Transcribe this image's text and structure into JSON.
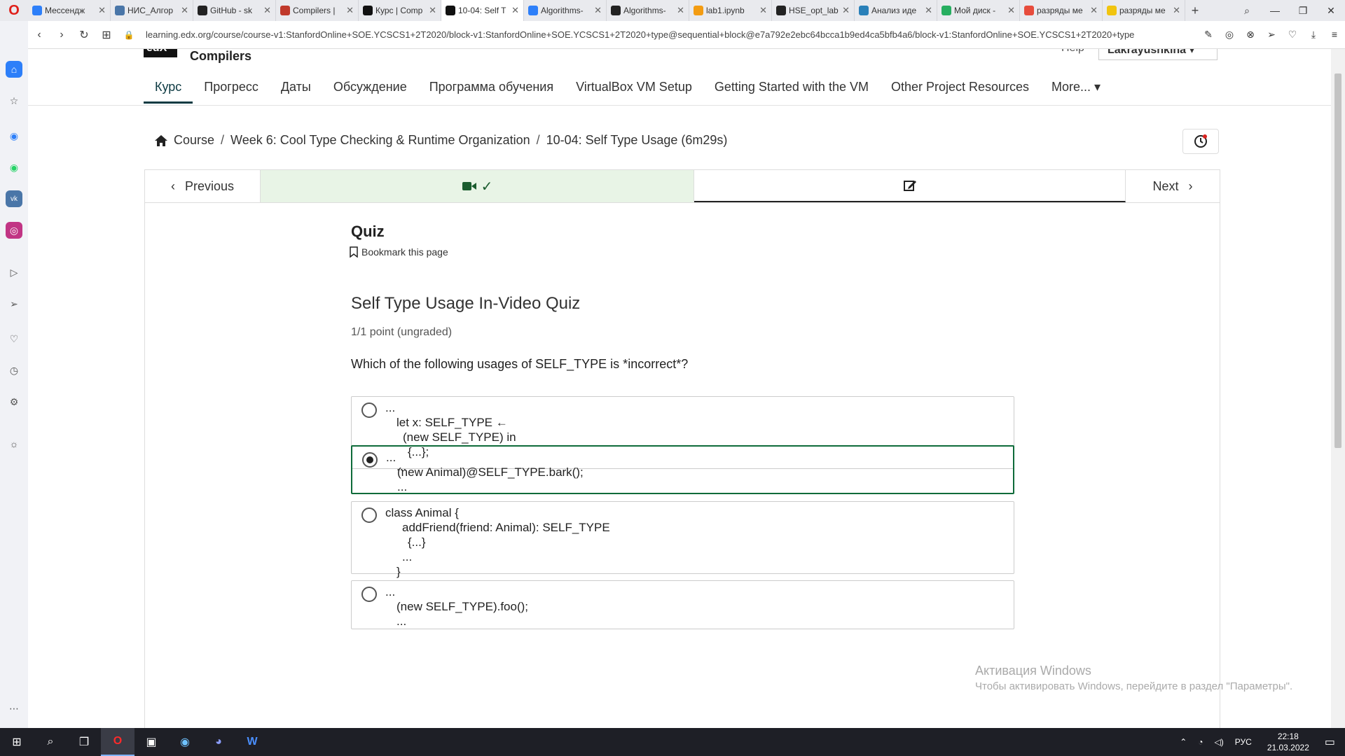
{
  "browser": {
    "tabs": [
      {
        "label": "Мессендж",
        "color": "#2d7ff9"
      },
      {
        "label": "НИС_Алгор",
        "color": "#4a76a8"
      },
      {
        "label": "GitHub - sk",
        "color": "#222222"
      },
      {
        "label": "Compilers |",
        "color": "#c0392b"
      },
      {
        "label": "Курс | Comp",
        "color": "#111111"
      },
      {
        "label": "10-04: Self T",
        "color": "#111111",
        "active": true
      },
      {
        "label": "Algorithms-",
        "color": "#2d7ff9"
      },
      {
        "label": "Algorithms-",
        "color": "#222222"
      },
      {
        "label": "lab1.ipynb",
        "color": "#f39c12"
      },
      {
        "label": "HSE_opt_lab",
        "color": "#222222"
      },
      {
        "label": "Анализ иде",
        "color": "#2980b9"
      },
      {
        "label": "Мой диск -",
        "color": "#27ae60"
      },
      {
        "label": "разряды ме",
        "color": "#e74c3c"
      },
      {
        "label": "разряды ме",
        "color": "#f1c40f"
      }
    ],
    "url": "learning.edx.org/course/course-v1:StanfordOnline+SOE.YCSCS1+2T2020/block-v1:StanfordOnline+SOE.YCSCS1+2T2020+type@sequential+block@e7a792e2ebc64bcca1b9ed4ca5bfb4a6/block-v1:StanfordOnline+SOE.YCSCS1+2T2020+type"
  },
  "header": {
    "course_title": "Compilers",
    "help": "Help",
    "username": "Lakrayushkina ▾"
  },
  "course_tabs": [
    "Курс",
    "Прогресс",
    "Даты",
    "Обсуждение",
    "Программа обучения",
    "VirtualBox VM Setup",
    "Getting Started with the VM",
    "Other Project Resources",
    "More... ▾"
  ],
  "breadcrumb": {
    "course": "Course",
    "week": "Week 6: Cool Type Checking & Runtime Organization",
    "unit": "10-04: Self Type Usage (6m29s)"
  },
  "sequence": {
    "previous": "Previous",
    "next": "Next"
  },
  "unit": {
    "title": "Quiz",
    "bookmark": "Bookmark this page"
  },
  "problem": {
    "title": "Self Type Usage In-Video Quiz",
    "points": "1/1 point (ungraded)",
    "question": "Which of the following usages of SELF_TYPE is *incorrect*?",
    "options": [
      {
        "lines": [
          "...",
          "let x: SELF_TYPE ←",
          "(new SELF_TYPE) in",
          "{...};",
          "..."
        ],
        "selected": false
      },
      {
        "lines": [
          "...",
          "(new Animal)@SELF_TYPE.bark();",
          "..."
        ],
        "selected": true
      },
      {
        "lines": [
          "class Animal {",
          "addFriend(friend: Animal): SELF_TYPE",
          "{...}",
          "...",
          "}"
        ],
        "selected": false
      },
      {
        "lines": [
          "...",
          "(new SELF_TYPE).foo();",
          "..."
        ],
        "selected": false
      }
    ]
  },
  "watermark": {
    "line1": "Активация Windows",
    "line2": "Чтобы активировать Windows, перейдите в раздел \"Параметры\"."
  },
  "taskbar": {
    "lang": "РУС",
    "time": "22:18",
    "date": "21.03.2022"
  }
}
